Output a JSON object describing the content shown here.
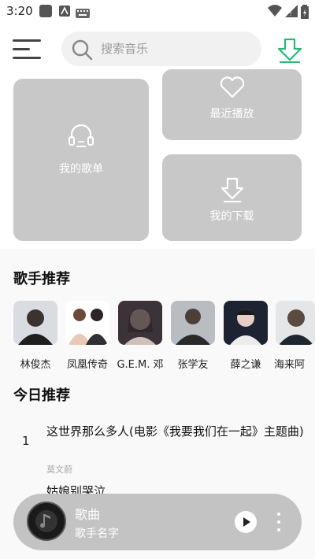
{
  "status_bar": {
    "time": "3:20"
  },
  "header": {
    "search_placeholder": "搜索音乐"
  },
  "cards": {
    "my_playlist": "我的歌单",
    "recent": "最近播放",
    "downloads": "我的下载"
  },
  "artists_section": {
    "title": "歌手推荐",
    "artists": [
      {
        "name": "林俊杰"
      },
      {
        "name": "凤凰传奇"
      },
      {
        "name": "G.E.M. 邓"
      },
      {
        "name": "张学友"
      },
      {
        "name": "薛之谦"
      },
      {
        "name": "海来阿"
      }
    ]
  },
  "today_section": {
    "title": "今日推荐",
    "songs": [
      {
        "rank": "1",
        "title": "这世界那么多人(电影《我要我们在一起》主题曲)",
        "artist": "莫文蔚"
      },
      {
        "title": "姑娘别哭泣"
      }
    ]
  },
  "player": {
    "title": "歌曲",
    "artist": "歌手名字"
  },
  "colors": {
    "accent": "#2bb673",
    "card_bg": "#c8c8c8",
    "player_bg": "#c3c3c3"
  }
}
